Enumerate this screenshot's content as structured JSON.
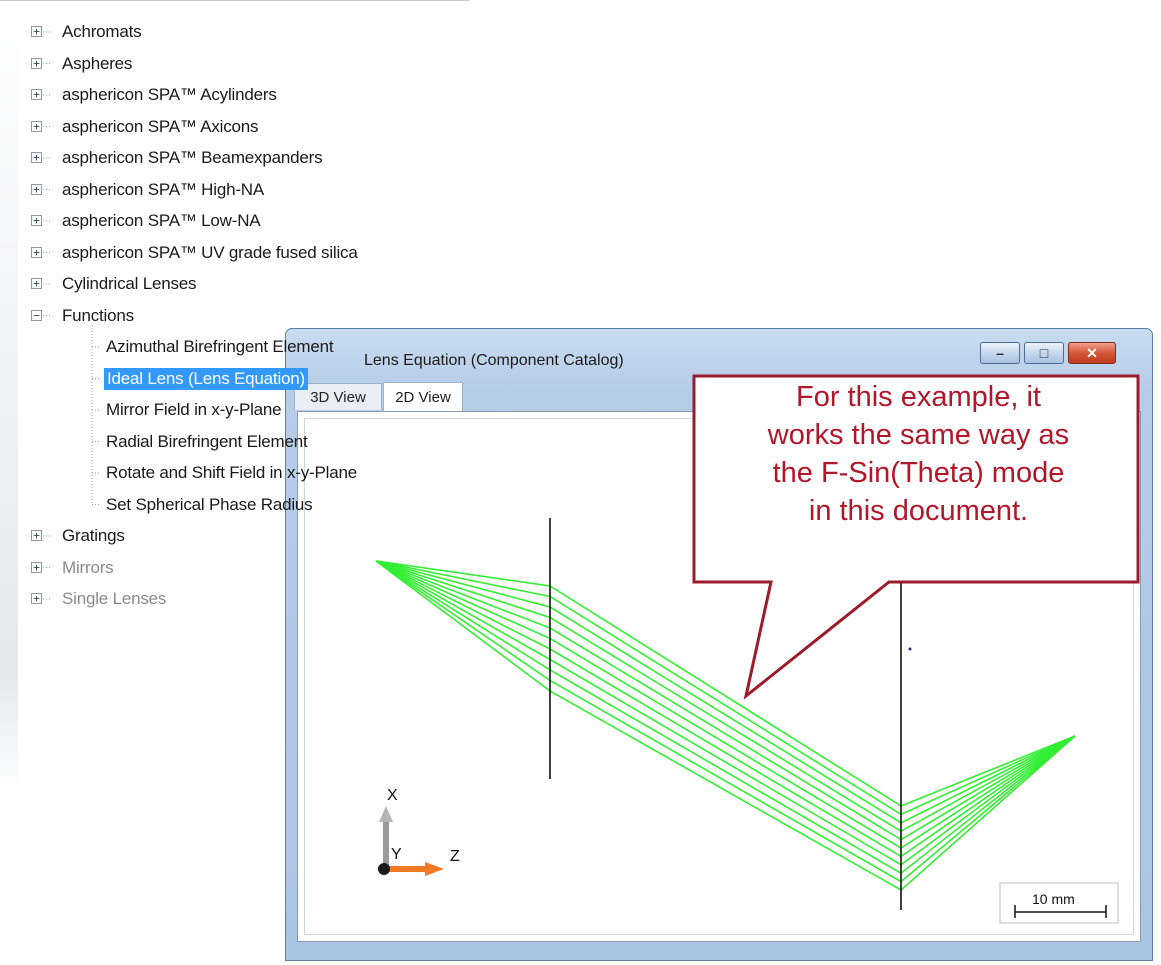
{
  "tree": {
    "items": [
      {
        "label": "Achromats",
        "expander": "+"
      },
      {
        "label": "Aspheres",
        "expander": "+"
      },
      {
        "label": "asphericon SPA™ Acylinders",
        "expander": "+"
      },
      {
        "label": "asphericon SPA™ Axicons",
        "expander": "+"
      },
      {
        "label": "asphericon SPA™ Beamexpanders",
        "expander": "+"
      },
      {
        "label": "asphericon SPA™ High-NA",
        "expander": "+"
      },
      {
        "label": "asphericon SPA™ Low-NA",
        "expander": "+"
      },
      {
        "label": "asphericon SPA™ UV grade fused silica",
        "expander": "+"
      },
      {
        "label": "Cylindrical Lenses",
        "expander": "+"
      },
      {
        "label": "Functions",
        "expander": "−"
      }
    ],
    "function_children": [
      {
        "label": "Azimuthal Birefringent Element"
      },
      {
        "label": "Ideal Lens (Lens Equation)",
        "selected": true
      },
      {
        "label": "Mirror Field in x-y-Plane"
      },
      {
        "label": "Radial Birefringent Element"
      },
      {
        "label": "Rotate and Shift Field in x-y-Plane"
      },
      {
        "label": "Set Spherical Phase Radius"
      }
    ],
    "items_after": [
      {
        "label": "Gratings",
        "expander": "+"
      },
      {
        "label": "Mirrors",
        "expander": "+"
      },
      {
        "label": "Single Lenses",
        "expander": "+"
      }
    ]
  },
  "window": {
    "title": "Lens Equation (Component Catalog)",
    "tabs": [
      "3D View",
      "2D View"
    ],
    "active_tab": "2D View",
    "buttons": {
      "minimize": "–",
      "maximize": "□",
      "close": "✕"
    }
  },
  "view": {
    "axis_x_label": "X",
    "axis_y_label": "Y",
    "axis_z_label": "Z",
    "scale_bar_label": "10 mm",
    "ray_color": "#33ee33"
  },
  "callout": {
    "text_lines": [
      "For this example, it",
      "works the same way as",
      "the F-Sin(Theta) mode",
      "in this document."
    ],
    "border_color": "#9b1c2c",
    "text_color": "#b0182a"
  }
}
